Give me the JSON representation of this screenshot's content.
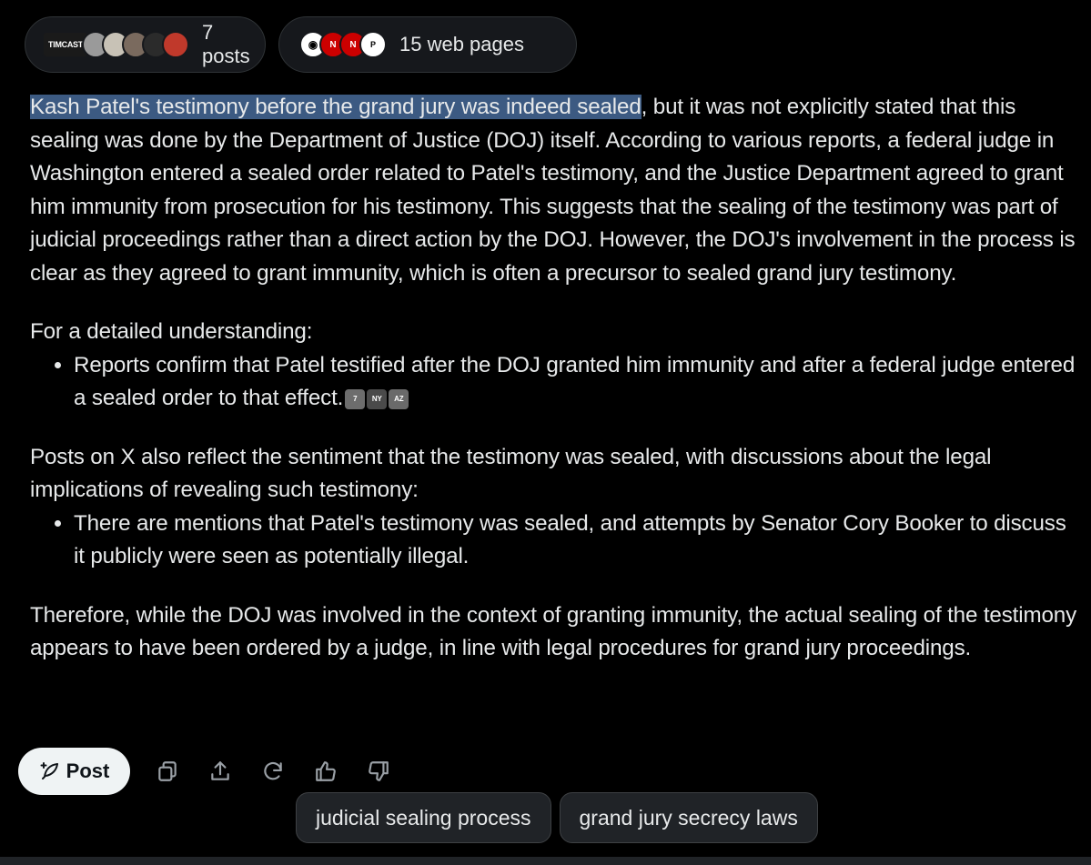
{
  "sources": {
    "posts_label": "7 posts",
    "web_label": "15 web pages",
    "posts_icons": [
      "timcast-logo-icon",
      "avatar-icon",
      "avatar-icon",
      "avatar-icon",
      "avatar-icon",
      "avatar-icon"
    ],
    "web_icons": [
      "cbs-logo-icon",
      "cnn-logo-icon",
      "cnn-logo-icon",
      "nbc-logo-icon"
    ]
  },
  "answer": {
    "p1_highlight": "Kash Patel's testimony before the grand jury was indeed sealed",
    "p1_rest": ", but it was not explicitly stated that this sealing was done by the Department of Justice (DOJ) itself. According to various reports, a federal judge in Washington entered a sealed order related to Patel's testimony, and the Justice Department agreed to grant him immunity from prosecution for his testimony. This suggests that the sealing of the testimony was part of judicial proceedings rather than a direct action by the DOJ. However, the DOJ's involvement in the process is clear as they agreed to grant immunity, which is often a precursor to sealed grand jury testimony.",
    "p2": "For a detailed understanding:",
    "p2_bullet": "Reports confirm that Patel testified after the DOJ granted him immunity and after a federal judge entered a sealed order to that effect.",
    "p3": "Posts on X also reflect the sentiment that the testimony was sealed, with discussions about the legal implications of revealing such testimony:",
    "p3_bullet": "There are mentions that Patel's testimony was sealed, and attempts by Senator Cory Booker to discuss it publicly were seen as potentially illegal.",
    "p4": "Therefore, while the DOJ was involved in the context of granting immunity, the actual sealing of the testimony appears to have been ordered by a judge, in line with legal procedures for grand jury proceedings."
  },
  "actions": {
    "post_label": "Post",
    "icons": [
      "copy-icon",
      "share-icon",
      "regenerate-icon",
      "thumbs-up-icon",
      "thumbs-down-icon"
    ]
  },
  "suggestions": [
    "judicial sealing process",
    "grand jury secrecy laws"
  ]
}
